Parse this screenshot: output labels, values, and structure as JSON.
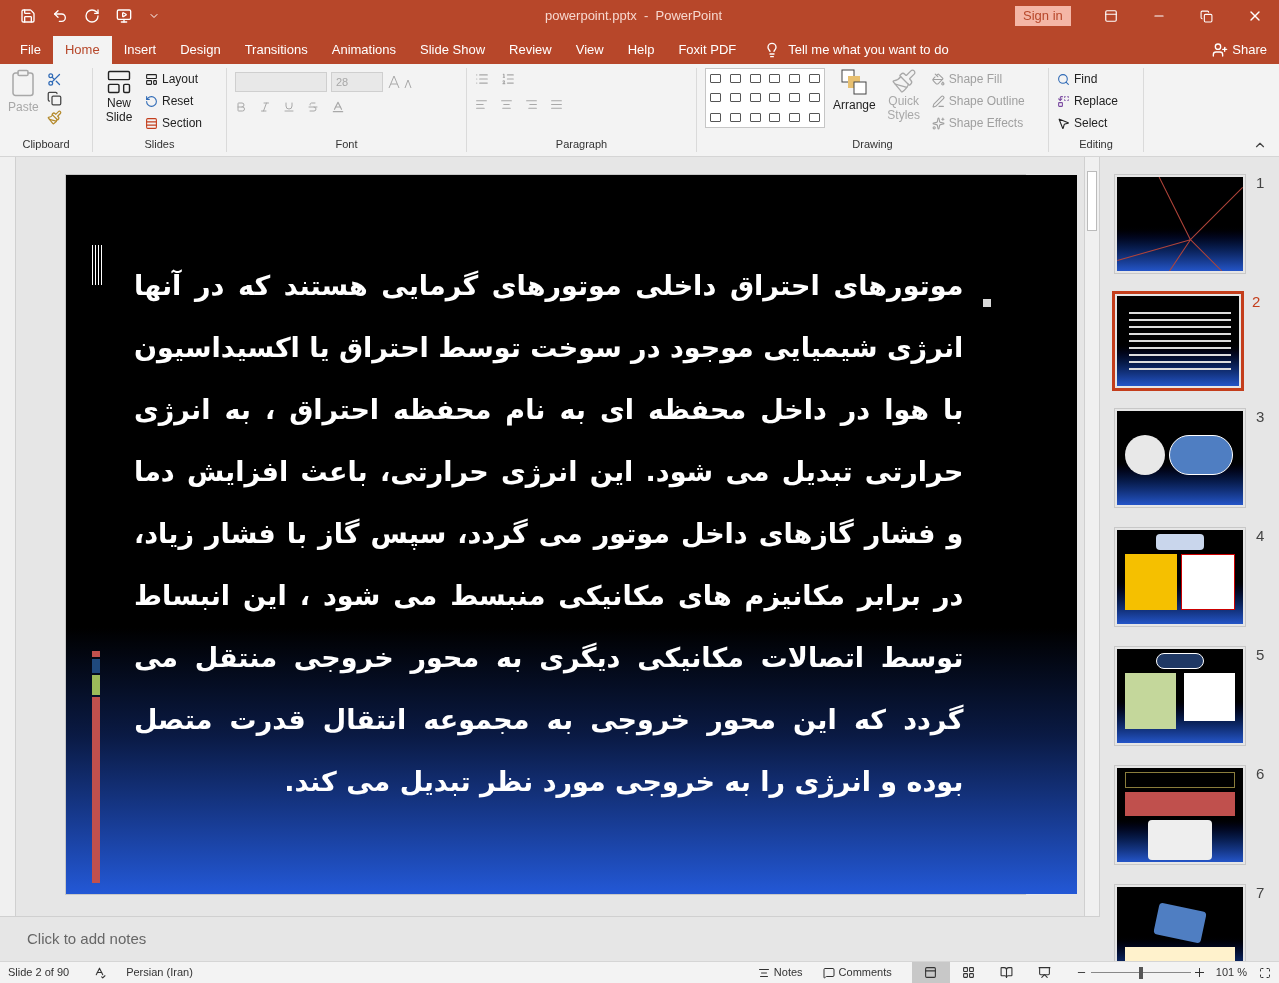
{
  "title_bar": {
    "document_title": "powerpoint.pptx  -  PowerPoint",
    "sign_in": "Sign in"
  },
  "menu_tabs": [
    {
      "label": "File",
      "selected": false
    },
    {
      "label": "Home",
      "selected": true
    },
    {
      "label": "Insert",
      "selected": false
    },
    {
      "label": "Design",
      "selected": false
    },
    {
      "label": "Transitions",
      "selected": false
    },
    {
      "label": "Animations",
      "selected": false
    },
    {
      "label": "Slide Show",
      "selected": false
    },
    {
      "label": "Review",
      "selected": false
    },
    {
      "label": "View",
      "selected": false
    },
    {
      "label": "Help",
      "selected": false
    },
    {
      "label": "Foxit PDF",
      "selected": false
    }
  ],
  "tell_me": "Tell me what you want to do",
  "share": "Share",
  "ribbon": {
    "clipboard": {
      "paste": "Paste",
      "label": "Clipboard"
    },
    "slides": {
      "new_slide": "New Slide",
      "items": [
        "Layout",
        "Reset",
        "Section"
      ],
      "label": "Slides"
    },
    "font": {
      "size": "28",
      "label": "Font"
    },
    "paragraph": {
      "label": "Paragraph"
    },
    "drawing": {
      "arrange": "Arrange",
      "quick_styles": "Quick Styles",
      "shape_items": [
        "Shape Fill",
        "Shape Outline",
        "Shape Effects"
      ],
      "label": "Drawing"
    },
    "editing": {
      "items": [
        "Find",
        "Replace",
        "Select"
      ],
      "label": "Editing"
    }
  },
  "slide": {
    "lines": [
      "موتورهای احتراق داخلی موتورهای گرمایی هستند که در آنها",
      "انرژی شیمیایی موجود در سوخت توسط احتراق یا اکسیداسیون",
      "با هوا در داخل محفظه ای به نام محفظه احتراق ، به انرژی",
      "حرارتی تبدیل می شود. این انرژی حرارتی، باعث افزایش دما",
      "و فشار گازهای داخل موتور می گردد، سپس گاز با فشار زیاد،",
      "در برابر مکانیزم های مکانیکی منبسط می شود ، این انبساط",
      "توسط اتصالات مکانیکی دیگری به محور خروجی منتقل می",
      "گردد که این محور خروجی  به مجموعه انتقال قدرت متصل",
      "بوده و انرژی را به خروجی مورد نظر تبدیل می کند."
    ]
  },
  "thumbnails": [
    {
      "number": "1",
      "selected": false,
      "kind": "rays"
    },
    {
      "number": "2",
      "selected": true,
      "kind": "text"
    },
    {
      "number": "3",
      "selected": false,
      "kind": "circles"
    },
    {
      "number": "4",
      "selected": false,
      "kind": "tdc"
    },
    {
      "number": "5",
      "selected": false,
      "kind": "bdc"
    },
    {
      "number": "6",
      "selected": false,
      "kind": "engine"
    },
    {
      "number": "7",
      "selected": false,
      "kind": "pistons"
    }
  ],
  "notes_placeholder": "Click to add notes",
  "status_bar": {
    "slide_counter": "Slide 2 of 90",
    "language": "Persian (Iran)",
    "notes": "Notes",
    "comments": "Comments",
    "views": [
      {
        "kind": "normal",
        "selected": true
      },
      {
        "kind": "sorter",
        "selected": false
      },
      {
        "kind": "reading",
        "selected": false
      },
      {
        "kind": "show",
        "selected": false
      }
    ],
    "zoom": {
      "level": 0.5,
      "reading": "101 %"
    }
  }
}
